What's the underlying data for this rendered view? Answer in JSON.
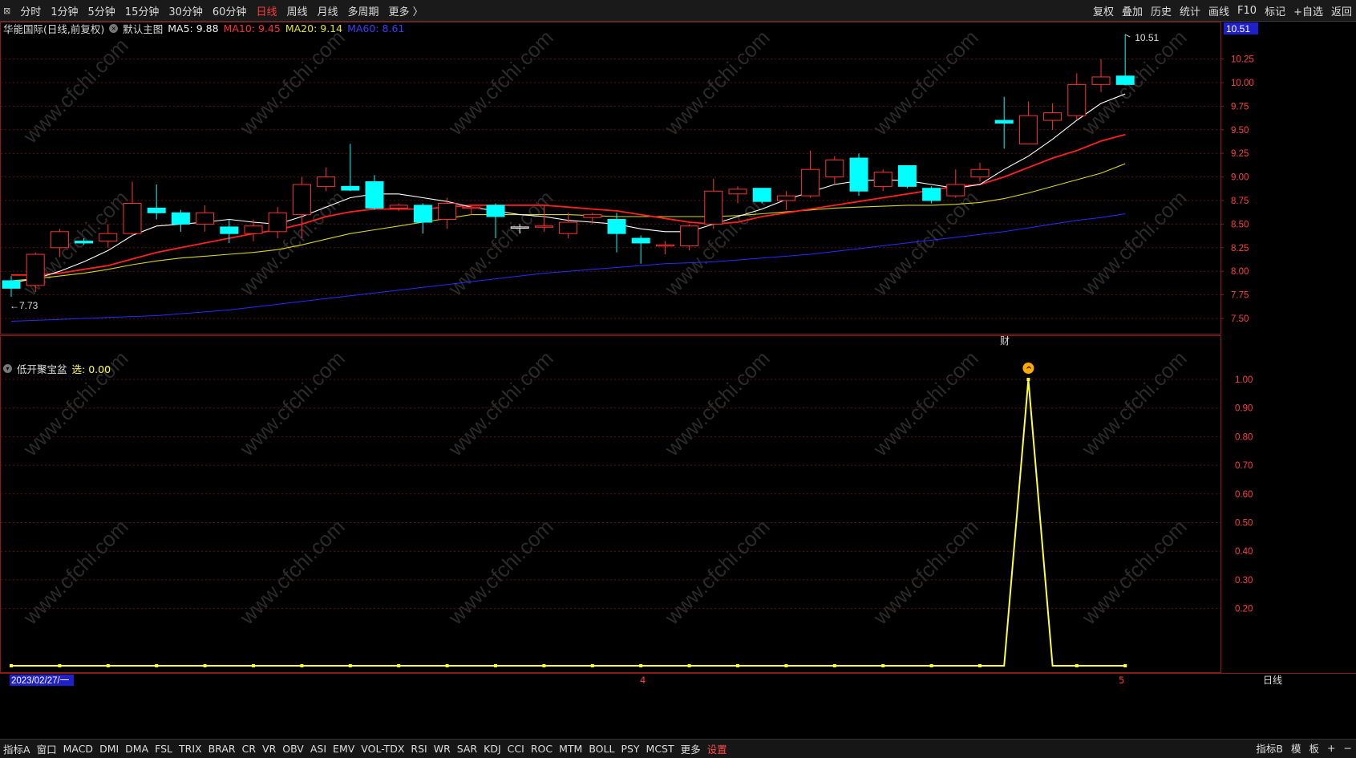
{
  "toolbar": {
    "control": "⊠",
    "timeframes": [
      "分时",
      "1分钟",
      "5分钟",
      "15分钟",
      "30分钟",
      "60分钟",
      "日线",
      "周线",
      "月线",
      "多周期",
      "更多 〉"
    ],
    "active_timeframe": "日线",
    "tools": [
      "复权",
      "叠加",
      "历史",
      "统计",
      "画线",
      "F10",
      "标记",
      "+自选",
      "返回"
    ]
  },
  "main_legend": {
    "stock": "华能国际(日线,前复权)",
    "template": "默认主图",
    "ma5": "MA5: 9.88",
    "ma10": "MA10: 9.45",
    "ma20": "MA20: 9.14",
    "ma60": "MA60: 8.61"
  },
  "indicator_legend": {
    "name": "低开聚宝盆",
    "value": "选: 0.00"
  },
  "colors": {
    "up": "#ff3232",
    "down": "#00ffff",
    "ma5": "#ffffff",
    "ma10": "#ff2020",
    "ma20": "#d6d621",
    "ma60": "#2a2aff",
    "signal": "#ffff33",
    "price_tag_bg": "#2020c8"
  },
  "price_labels": {
    "high_label": "10.51",
    "low_label": "7.73",
    "current_tag": "10.51",
    "marker": "财",
    "signal_icon": "^"
  },
  "price_axis": [
    "10.25",
    "10.00",
    "9.75",
    "9.50",
    "9.25",
    "9.00",
    "8.75",
    "8.50",
    "8.25",
    "8.00",
    "7.75",
    "7.50"
  ],
  "indicator_axis": [
    "1.00",
    "0.90",
    "0.80",
    "0.70",
    "0.60",
    "0.50",
    "0.40",
    "0.30",
    "0.20"
  ],
  "date_labels": {
    "start": "2023/02/27/一",
    "month_4": "4",
    "month_5": "5",
    "period": "日线"
  },
  "bottom_tabs": [
    "指标A",
    "窗口",
    "MACD",
    "DMI",
    "DMA",
    "FSL",
    "TRIX",
    "BRAR",
    "CR",
    "VR",
    "OBV",
    "ASI",
    "EMV",
    "VOL-TDX",
    "RSI",
    "WR",
    "SAR",
    "KDJ",
    "CCI",
    "ROC",
    "MTM",
    "BOLL",
    "PSY",
    "MCST",
    "更多",
    "设置"
  ],
  "bottom_right": [
    "指标B",
    "模",
    "板",
    "+",
    "−"
  ],
  "chart_data": [
    {
      "type": "candlestick",
      "title": "华能国际(日线,前复权)",
      "ylim": [
        7.4,
        10.5
      ],
      "candles": [
        {
          "o": 7.9,
          "h": 7.95,
          "l": 7.73,
          "c": 7.82
        },
        {
          "o": 7.85,
          "h": 8.2,
          "l": 7.78,
          "c": 8.18
        },
        {
          "o": 8.25,
          "h": 8.45,
          "l": 8.15,
          "c": 8.42
        },
        {
          "o": 8.32,
          "h": 8.35,
          "l": 8.28,
          "c": 8.3
        },
        {
          "o": 8.32,
          "h": 8.5,
          "l": 8.25,
          "c": 8.4
        },
        {
          "o": 8.4,
          "h": 8.95,
          "l": 8.38,
          "c": 8.72
        },
        {
          "o": 8.67,
          "h": 8.92,
          "l": 8.55,
          "c": 8.62
        },
        {
          "o": 8.62,
          "h": 8.65,
          "l": 8.42,
          "c": 8.5
        },
        {
          "o": 8.5,
          "h": 8.7,
          "l": 8.42,
          "c": 8.62
        },
        {
          "o": 8.47,
          "h": 8.55,
          "l": 8.3,
          "c": 8.4
        },
        {
          "o": 8.4,
          "h": 8.55,
          "l": 8.32,
          "c": 8.48
        },
        {
          "o": 8.42,
          "h": 8.68,
          "l": 8.35,
          "c": 8.62
        },
        {
          "o": 8.6,
          "h": 9.0,
          "l": 8.35,
          "c": 8.92
        },
        {
          "o": 8.9,
          "h": 9.1,
          "l": 8.85,
          "c": 9.0
        },
        {
          "o": 8.9,
          "h": 9.35,
          "l": 8.85,
          "c": 8.86
        },
        {
          "o": 8.95,
          "h": 9.02,
          "l": 8.65,
          "c": 8.67
        },
        {
          "o": 8.67,
          "h": 8.72,
          "l": 8.64,
          "c": 8.7
        },
        {
          "o": 8.7,
          "h": 8.72,
          "l": 8.4,
          "c": 8.52
        },
        {
          "o": 8.55,
          "h": 8.78,
          "l": 8.45,
          "c": 8.72
        },
        {
          "o": 8.67,
          "h": 8.7,
          "l": 8.6,
          "c": 8.68
        },
        {
          "o": 8.7,
          "h": 8.72,
          "l": 8.35,
          "c": 8.58
        },
        {
          "o": 8.47,
          "h": 8.5,
          "l": 8.4,
          "c": 8.47
        },
        {
          "o": 8.47,
          "h": 8.7,
          "l": 8.42,
          "c": 8.48
        },
        {
          "o": 8.4,
          "h": 8.62,
          "l": 8.35,
          "c": 8.52
        },
        {
          "o": 8.57,
          "h": 8.62,
          "l": 8.5,
          "c": 8.6
        },
        {
          "o": 8.55,
          "h": 8.62,
          "l": 8.2,
          "c": 8.4
        },
        {
          "o": 8.35,
          "h": 8.38,
          "l": 8.08,
          "c": 8.3
        },
        {
          "o": 8.27,
          "h": 8.32,
          "l": 8.18,
          "c": 8.28
        },
        {
          "o": 8.27,
          "h": 8.5,
          "l": 8.22,
          "c": 8.48
        },
        {
          "o": 8.5,
          "h": 8.98,
          "l": 8.45,
          "c": 8.85
        },
        {
          "o": 8.82,
          "h": 8.9,
          "l": 8.72,
          "c": 8.87
        },
        {
          "o": 8.88,
          "h": 8.88,
          "l": 8.72,
          "c": 8.74
        },
        {
          "o": 8.75,
          "h": 8.85,
          "l": 8.65,
          "c": 8.8
        },
        {
          "o": 8.8,
          "h": 9.28,
          "l": 8.78,
          "c": 9.08
        },
        {
          "o": 9.0,
          "h": 9.22,
          "l": 8.92,
          "c": 9.18
        },
        {
          "o": 9.2,
          "h": 9.25,
          "l": 8.8,
          "c": 8.85
        },
        {
          "o": 8.9,
          "h": 9.08,
          "l": 8.85,
          "c": 9.05
        },
        {
          "o": 9.12,
          "h": 9.12,
          "l": 8.88,
          "c": 8.9
        },
        {
          "o": 8.88,
          "h": 8.9,
          "l": 8.72,
          "c": 8.75
        },
        {
          "o": 8.8,
          "h": 9.08,
          "l": 8.78,
          "c": 8.92
        },
        {
          "o": 9.0,
          "h": 9.15,
          "l": 8.95,
          "c": 9.08
        },
        {
          "o": 9.6,
          "h": 9.85,
          "l": 9.3,
          "c": 9.57
        },
        {
          "o": 9.35,
          "h": 9.8,
          "l": 9.35,
          "c": 9.65
        },
        {
          "o": 9.6,
          "h": 9.78,
          "l": 9.5,
          "c": 9.68
        },
        {
          "o": 9.65,
          "h": 10.1,
          "l": 9.6,
          "c": 9.98
        },
        {
          "o": 9.98,
          "h": 10.25,
          "l": 9.9,
          "c": 10.06
        },
        {
          "o": 10.07,
          "h": 10.51,
          "l": 9.97,
          "c": 9.98
        }
      ],
      "ma5": [
        7.88,
        7.92,
        8.0,
        8.1,
        8.22,
        8.38,
        8.48,
        8.5,
        8.52,
        8.55,
        8.52,
        8.5,
        8.58,
        8.68,
        8.78,
        8.82,
        8.82,
        8.78,
        8.74,
        8.68,
        8.64,
        8.6,
        8.58,
        8.54,
        8.52,
        8.5,
        8.45,
        8.42,
        8.42,
        8.5,
        8.58,
        8.66,
        8.76,
        8.84,
        8.92,
        8.96,
        8.97,
        8.96,
        8.92,
        8.88,
        8.92,
        9.08,
        9.22,
        9.4,
        9.6,
        9.78,
        9.88
      ],
      "ma10": [
        7.96,
        7.96,
        7.98,
        8.02,
        8.06,
        8.13,
        8.2,
        8.25,
        8.3,
        8.35,
        8.4,
        8.44,
        8.5,
        8.58,
        8.63,
        8.66,
        8.66,
        8.66,
        8.68,
        8.7,
        8.7,
        8.7,
        8.7,
        8.68,
        8.66,
        8.64,
        8.6,
        8.56,
        8.52,
        8.5,
        8.52,
        8.58,
        8.62,
        8.66,
        8.7,
        8.74,
        8.78,
        8.82,
        8.86,
        8.9,
        8.92,
        9.0,
        9.1,
        9.2,
        9.28,
        9.38,
        9.45
      ],
      "ma20": [
        7.9,
        7.92,
        7.95,
        7.98,
        8.02,
        8.07,
        8.11,
        8.14,
        8.16,
        8.18,
        8.2,
        8.23,
        8.28,
        8.34,
        8.4,
        8.44,
        8.48,
        8.52,
        8.56,
        8.6,
        8.6,
        8.6,
        8.6,
        8.6,
        8.59,
        8.58,
        8.58,
        8.58,
        8.58,
        8.58,
        8.59,
        8.61,
        8.63,
        8.65,
        8.67,
        8.68,
        8.69,
        8.7,
        8.7,
        8.71,
        8.73,
        8.77,
        8.83,
        8.9,
        8.97,
        9.04,
        9.14
      ],
      "ma60": [
        7.47,
        7.48,
        7.49,
        7.5,
        7.51,
        7.52,
        7.53,
        7.55,
        7.57,
        7.59,
        7.62,
        7.65,
        7.68,
        7.71,
        7.74,
        7.77,
        7.8,
        7.83,
        7.86,
        7.89,
        7.92,
        7.95,
        7.98,
        8.0,
        8.02,
        8.04,
        8.06,
        8.08,
        8.09,
        8.1,
        8.12,
        8.14,
        8.16,
        8.18,
        8.21,
        8.24,
        8.27,
        8.3,
        8.33,
        8.36,
        8.39,
        8.42,
        8.46,
        8.5,
        8.54,
        8.57,
        8.61
      ]
    },
    {
      "type": "line",
      "title": "低开聚宝盆",
      "ylim": [
        0,
        1.1
      ],
      "series": [
        {
          "name": "选",
          "values": [
            0,
            0,
            0,
            0,
            0,
            0,
            0,
            0,
            0,
            0,
            0,
            0,
            0,
            0,
            0,
            0,
            0,
            0,
            0,
            0,
            0,
            0,
            0,
            0,
            0,
            0,
            0,
            0,
            0,
            0,
            0,
            0,
            0,
            0,
            0,
            0,
            0,
            0,
            0,
            0,
            0,
            0,
            1,
            0,
            0,
            0,
            0
          ]
        }
      ]
    }
  ]
}
